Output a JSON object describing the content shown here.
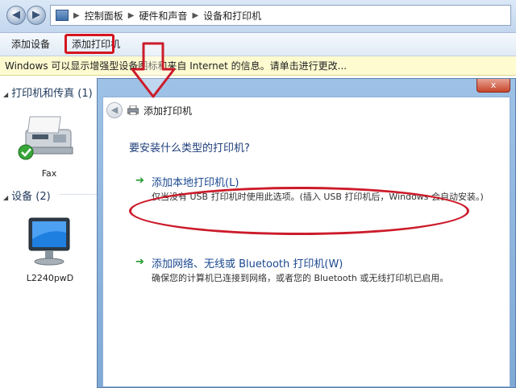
{
  "address_bar": {
    "crumbs": [
      "控制面板",
      "硬件和声音",
      "设备和打印机"
    ]
  },
  "toolbar": {
    "add_device": "添加设备",
    "add_printer": "添加打印机"
  },
  "infobar": {
    "text": "Windows 可以显示增强型设备图标和来自 Internet 的信息。请单击进行更改..."
  },
  "leftpane": {
    "printers_group": "打印机和传真 (1)",
    "devices_group": "设备 (2)",
    "fax_label": "Fax",
    "monitor_label": "L2240pwD"
  },
  "dialog": {
    "close": "x",
    "title": "添加打印机",
    "question": "要安装什么类型的打印机?",
    "option_local": {
      "title": "添加本地打印机(L)",
      "desc": "仅当没有 USB 打印机时使用此选项。(插入 USB 打印机后，Windows 会自动安装。)"
    },
    "option_network": {
      "title": "添加网络、无线或 Bluetooth 打印机(W)",
      "desc": "确保您的计算机已连接到网络，或者您的 Bluetooth 或无线打印机已启用。"
    }
  },
  "colors": {
    "annotation_red": "#cc1b2a",
    "link_blue": "#1a4890",
    "arrow_green": "#1f9a2c",
    "infobar_yellow": "#fffbd0"
  }
}
